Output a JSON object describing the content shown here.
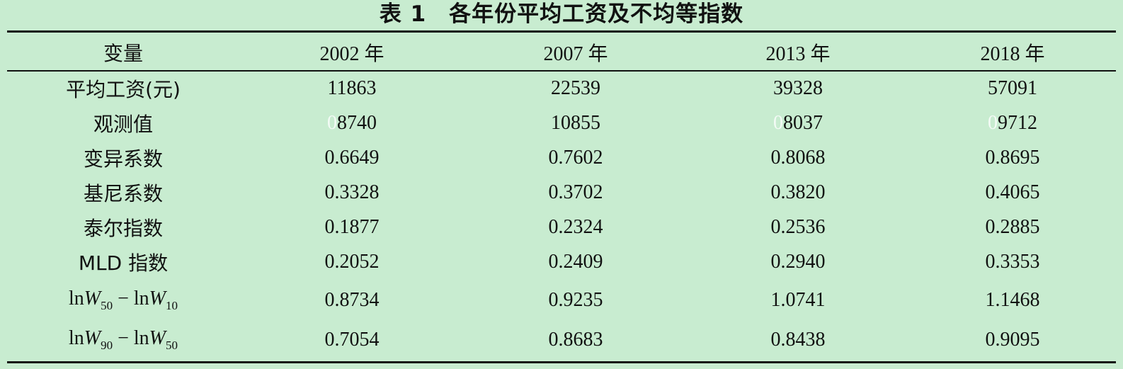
{
  "title": "表 1　各年份平均工资及不均等指数",
  "header": [
    "变量",
    "2002 年",
    "2007 年",
    "2013 年",
    "2018 年"
  ],
  "rows": [
    {
      "label": "平均工资(元)",
      "values": [
        "11863",
        "22539",
        "39328",
        "57091"
      ]
    },
    {
      "label": "观测值",
      "values": [
        "08740",
        "10855",
        "08037",
        "09712"
      ]
    },
    {
      "label": "变异系数",
      "values": [
        "0.6649",
        "0.7602",
        "0.8068",
        "0.8695"
      ]
    },
    {
      "label": "基尼系数",
      "values": [
        "0.3328",
        "0.3702",
        "0.3820",
        "0.4065"
      ]
    },
    {
      "label": "泰尔指数",
      "values": [
        "0.1877",
        "0.2324",
        "0.2536",
        "0.2885"
      ]
    },
    {
      "label": "MLD 指数",
      "values": [
        "0.2052",
        "0.2409",
        "0.2940",
        "0.3353"
      ]
    },
    {
      "label_parts": {
        "a": "ln",
        "b": "W",
        "c": "50",
        "d": " − ln",
        "e": "W",
        "f": "10"
      },
      "values": [
        "0.8734",
        "0.9235",
        "1.0741",
        "1.1468"
      ]
    },
    {
      "label_parts": {
        "a": "ln",
        "b": "W",
        "c": "90",
        "d": " − ln",
        "e": "W",
        "f": "50"
      },
      "values": [
        "0.7054",
        "0.8683",
        "0.8438",
        "0.9095"
      ]
    }
  ]
}
